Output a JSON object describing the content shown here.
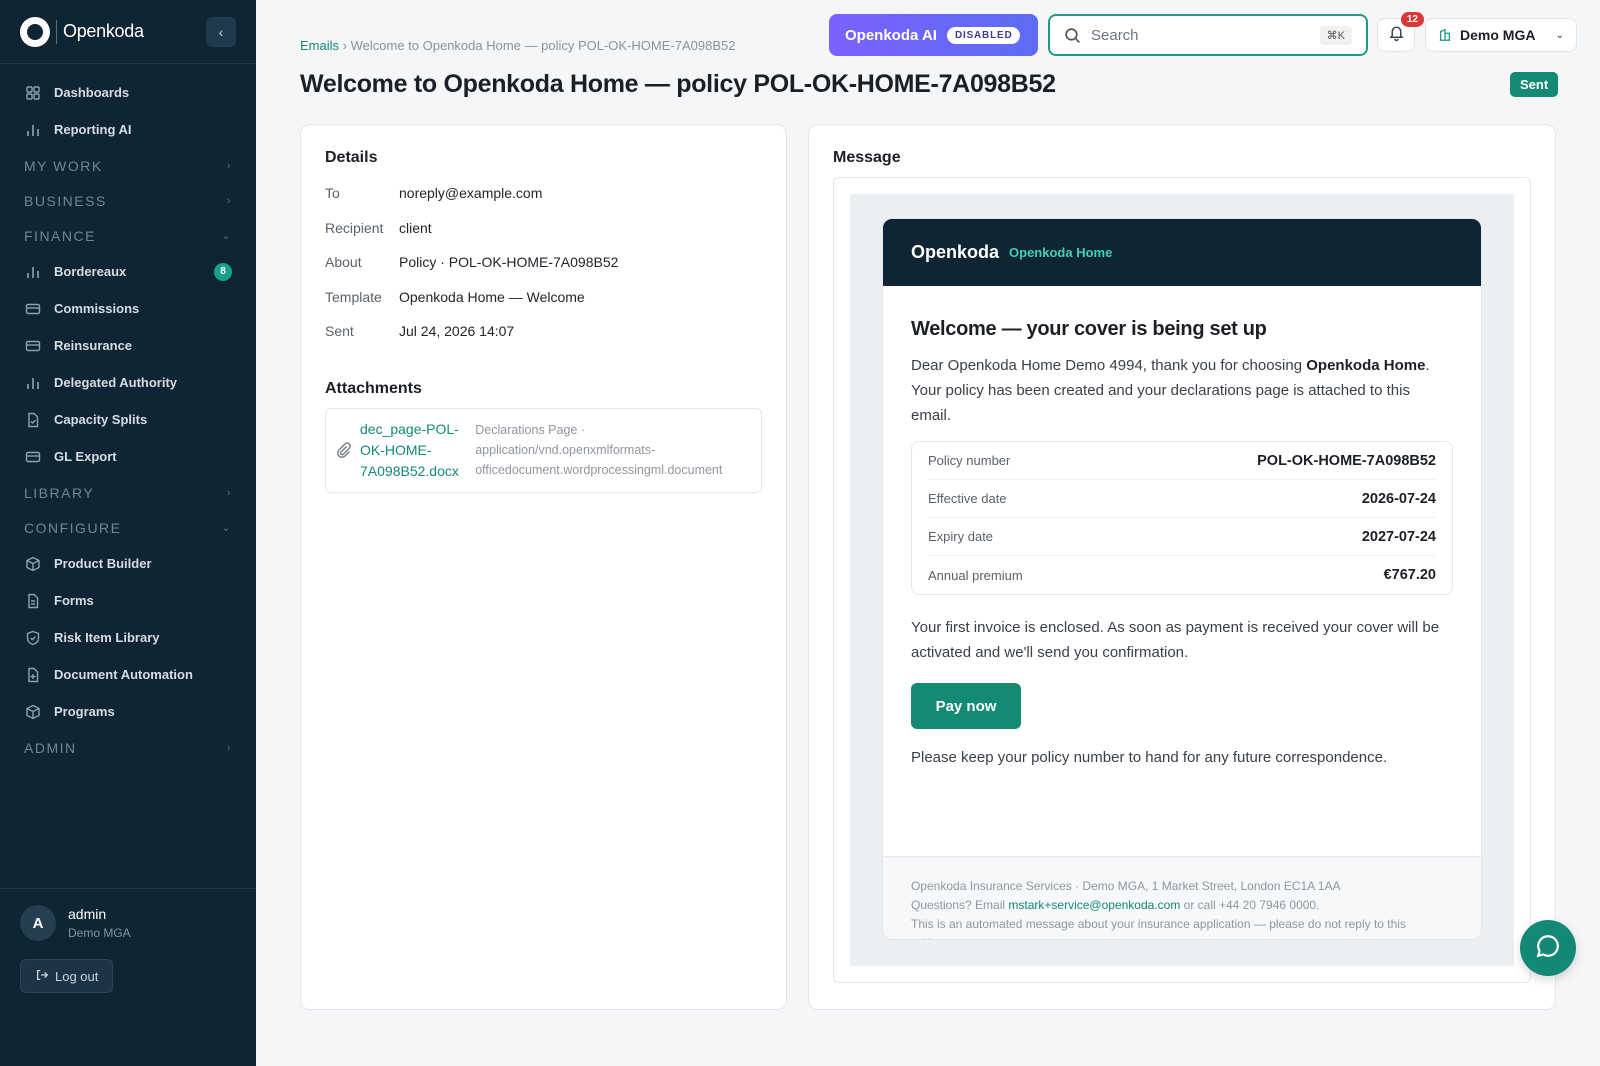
{
  "brand": {
    "name": "Openkoda"
  },
  "sidebar": {
    "items": [
      {
        "type": "item",
        "label": "Dashboards",
        "icon": "grid-icon"
      },
      {
        "type": "item",
        "label": "Reporting AI",
        "icon": "bar-chart-icon"
      },
      {
        "type": "section",
        "label": "MY WORK",
        "expanded": false
      },
      {
        "type": "section",
        "label": "BUSINESS",
        "expanded": false
      },
      {
        "type": "section",
        "label": "FINANCE",
        "expanded": true
      },
      {
        "type": "item",
        "label": "Bordereaux",
        "icon": "bar-chart-icon",
        "badge": "8"
      },
      {
        "type": "item",
        "label": "Commissions",
        "icon": "card-icon"
      },
      {
        "type": "item",
        "label": "Reinsurance",
        "icon": "card-icon"
      },
      {
        "type": "item",
        "label": "Delegated Authority",
        "icon": "bar-chart-icon"
      },
      {
        "type": "item",
        "label": "Capacity Splits",
        "icon": "doc-check-icon"
      },
      {
        "type": "item",
        "label": "GL Export",
        "icon": "card-icon"
      },
      {
        "type": "section",
        "label": "LIBRARY",
        "expanded": false
      },
      {
        "type": "section",
        "label": "CONFIGURE",
        "expanded": true
      },
      {
        "type": "item",
        "label": "Product Builder",
        "icon": "box-icon"
      },
      {
        "type": "item",
        "label": "Forms",
        "icon": "doc-icon"
      },
      {
        "type": "item",
        "label": "Risk Item Library",
        "icon": "shield-icon"
      },
      {
        "type": "item",
        "label": "Document Automation",
        "icon": "doc-plus-icon"
      },
      {
        "type": "item",
        "label": "Programs",
        "icon": "box-icon"
      },
      {
        "type": "section",
        "label": "ADMIN",
        "expanded": false
      }
    ],
    "user": {
      "initial": "A",
      "name": "admin",
      "org": "Demo MGA"
    },
    "logout_label": "Log out"
  },
  "topbar": {
    "ai_label": "Openkoda AI",
    "ai_status": "DISABLED",
    "search_placeholder": "Search",
    "search_shortcut": "⌘K",
    "notifications": "12",
    "org": "Demo MGA"
  },
  "breadcrumb": {
    "parent": "Emails",
    "separator": "›",
    "current": "Welcome to Openkoda Home — policy POL-OK-HOME-7A098B52"
  },
  "page": {
    "title": "Welcome to Openkoda Home — policy POL-OK-HOME-7A098B52",
    "status": "Sent"
  },
  "details": {
    "heading": "Details",
    "rows": [
      {
        "key": "To",
        "value": "noreply@example.com"
      },
      {
        "key": "Recipient",
        "value": "client"
      },
      {
        "key": "About",
        "value": "Policy · POL-OK-HOME-7A098B52"
      },
      {
        "key": "Template",
        "value": "Openkoda Home — Welcome"
      },
      {
        "key": "Sent",
        "value": "Jul 24, 2026 14:07"
      }
    ],
    "attachments_heading": "Attachments",
    "attachments": [
      {
        "name": "dec_page-POL-OK-HOME-7A098B52.docx",
        "name_lines": [
          "dec_page-POL-",
          "OK-HOME-",
          "7A098B52.docx"
        ],
        "meta_lines": [
          "Declarations Page ·",
          "application/vnd.openxmlformats-",
          "officedocument.wordprocessingml.document"
        ]
      }
    ]
  },
  "message": {
    "heading": "Message",
    "email": {
      "brand": "Openkoda",
      "product": "Openkoda Home",
      "title": "Welcome — your cover is being set up",
      "intro_pre": "Dear Openkoda Home Demo 4994, thank you for choosing ",
      "intro_bold": "Openkoda Home",
      "intro_post": ". Your policy has been created and your declarations page is attached to this email.",
      "rows": [
        {
          "key": "Policy number",
          "value": "POL-OK-HOME-7A098B52"
        },
        {
          "key": "Effective date",
          "value": "2026-07-24"
        },
        {
          "key": "Expiry date",
          "value": "2027-07-24"
        },
        {
          "key": "Annual premium",
          "value": "€767.20"
        }
      ],
      "invoice_text": "Your first invoice is enclosed. As soon as payment is received your cover will be activated and we'll send you confirmation.",
      "pay_label": "Pay now",
      "keep_text": "Please keep your policy number to hand for any future correspondence.",
      "footer_line1": "Openkoda Insurance Services · Demo MGA, 1 Market Street, London EC1A 1AA",
      "footer_q_pre": "Questions? Email ",
      "footer_email": "mstark+service@openkoda.com",
      "footer_q_post": " or call +44 20 7946 0000.",
      "footer_line3": "This is an automated message about your insurance application — please do not reply to this address."
    }
  },
  "colors": {
    "sidebar_bg": "#0f2533",
    "accent": "#148a72",
    "ai_gradient_start": "#7b61ff"
  }
}
